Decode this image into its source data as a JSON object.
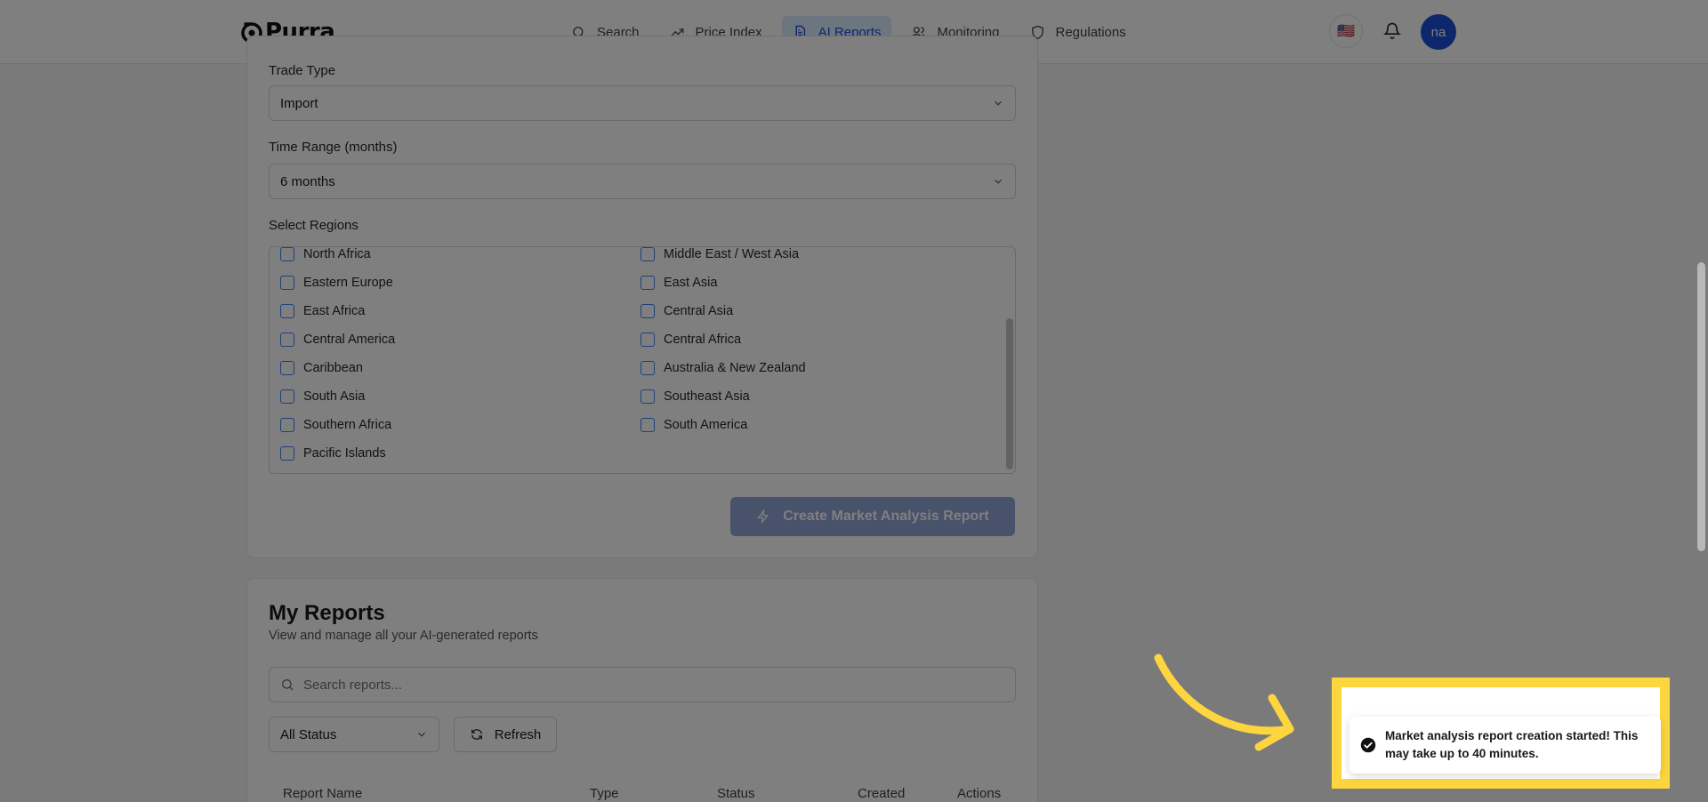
{
  "brand": {
    "name": "Purra"
  },
  "nav": [
    {
      "label": "Search",
      "icon": "search-icon"
    },
    {
      "label": "Price Index",
      "icon": "trend-icon"
    },
    {
      "label": "AI Reports",
      "icon": "document-icon",
      "active": true
    },
    {
      "label": "Monitoring",
      "icon": "users-icon"
    },
    {
      "label": "Regulations",
      "icon": "shield-icon"
    }
  ],
  "header": {
    "flag": "🇺🇸",
    "avatar_initials": "na"
  },
  "form": {
    "trade_type_label": "Trade Type",
    "trade_type_value": "Import",
    "time_range_label": "Time Range (months)",
    "time_range_value": "6 months",
    "regions_label": "Select Regions",
    "regions_left": [
      "North Africa",
      "Eastern Europe",
      "East Africa",
      "Central America",
      "Caribbean",
      "South Asia",
      "Southern Africa",
      "Pacific Islands"
    ],
    "regions_right": [
      "Middle East / West Asia",
      "East Asia",
      "Central Asia",
      "Central Africa",
      "Australia & New Zealand",
      "Southeast Asia",
      "South America"
    ],
    "create_button": "Create Market Analysis Report"
  },
  "reports": {
    "title": "My Reports",
    "subtitle": "View and manage all your AI-generated reports",
    "search_placeholder": "Search reports...",
    "status_filter": "All Status",
    "refresh_label": "Refresh",
    "columns": [
      "Report Name",
      "Type",
      "Status",
      "Created",
      "Actions"
    ]
  },
  "toast": {
    "message": "Market analysis report creation started! This may take up to 40 minutes."
  },
  "colors": {
    "accent": "#1d4ed8",
    "highlight": "#fcd53f",
    "button_disabled": "#93a5d6"
  }
}
